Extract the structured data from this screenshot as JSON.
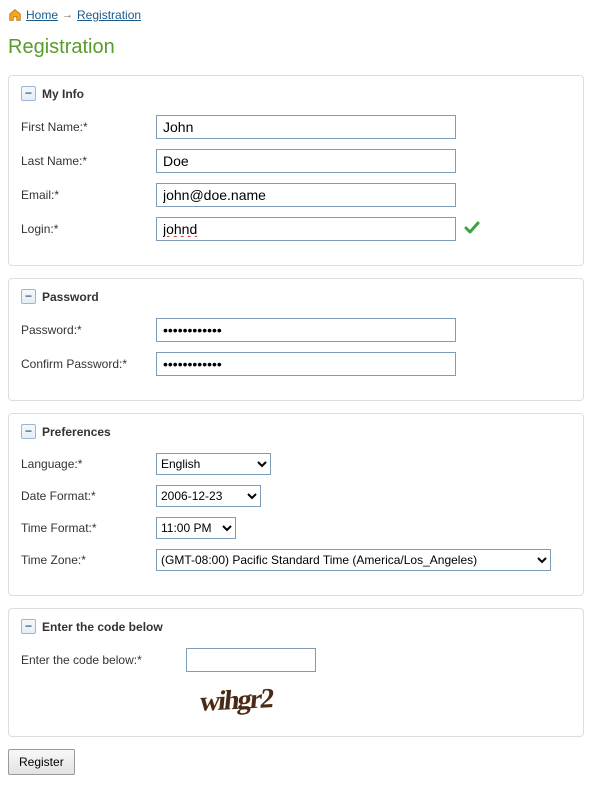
{
  "breadcrumb": {
    "home": "Home",
    "current": "Registration"
  },
  "page_title": "Registration",
  "sections": {
    "myinfo": {
      "title": "My Info",
      "first_name_label": "First Name:*",
      "first_name_value": "John",
      "last_name_label": "Last Name:*",
      "last_name_value": "Doe",
      "email_label": "Email:*",
      "email_value": "john@doe.name",
      "login_label": "Login:*",
      "login_value": "johnd"
    },
    "password": {
      "title": "Password",
      "password_label": "Password:*",
      "password_value": "••••••••••••",
      "confirm_label": "Confirm Password:*",
      "confirm_value": "••••••••••••"
    },
    "preferences": {
      "title": "Preferences",
      "language_label": "Language:*",
      "language_value": "English",
      "date_format_label": "Date Format:*",
      "date_format_value": "2006-12-23",
      "time_format_label": "Time Format:*",
      "time_format_value": "11:00 PM",
      "timezone_label": "Time Zone:*",
      "timezone_value": "(GMT-08:00) Pacific Standard Time (America/Los_Angeles)"
    },
    "captcha": {
      "title": "Enter the code below",
      "label": "Enter the code below:*",
      "value": "",
      "image_text": "wihgr2"
    }
  },
  "buttons": {
    "register": "Register"
  }
}
